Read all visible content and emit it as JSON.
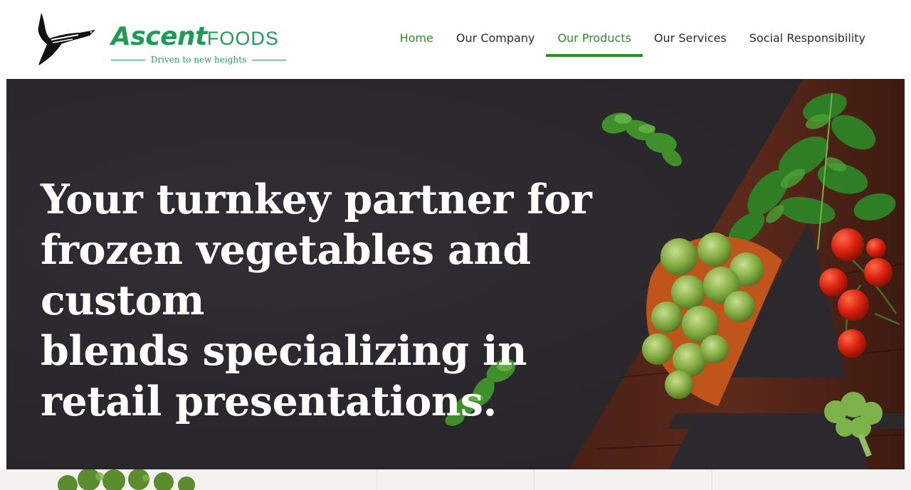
{
  "brand": {
    "name_primary": "Ascent",
    "name_secondary": "FOODS",
    "tagline": "Driven to new heights",
    "logo_icon": "bird-icon",
    "color": "#1f9b58"
  },
  "nav": {
    "items": [
      {
        "label": "Home"
      },
      {
        "label": "Our Company"
      },
      {
        "label": "Our Products"
      },
      {
        "label": "Our Services"
      },
      {
        "label": "Social Responsibility"
      }
    ],
    "active": "Our Products",
    "accent_color": "#2f8a2a"
  },
  "hero": {
    "headline_lines": [
      "Your turnkey partner for",
      "frozen vegetables and custom",
      "blends specializing in",
      "retail presentations."
    ],
    "background_color": "#2b292e",
    "decor_icons": [
      "parsley-icon",
      "brussels-sprouts-icon",
      "cherry-tomato-icon",
      "broccoli-icon",
      "letter-a-graphic"
    ]
  }
}
